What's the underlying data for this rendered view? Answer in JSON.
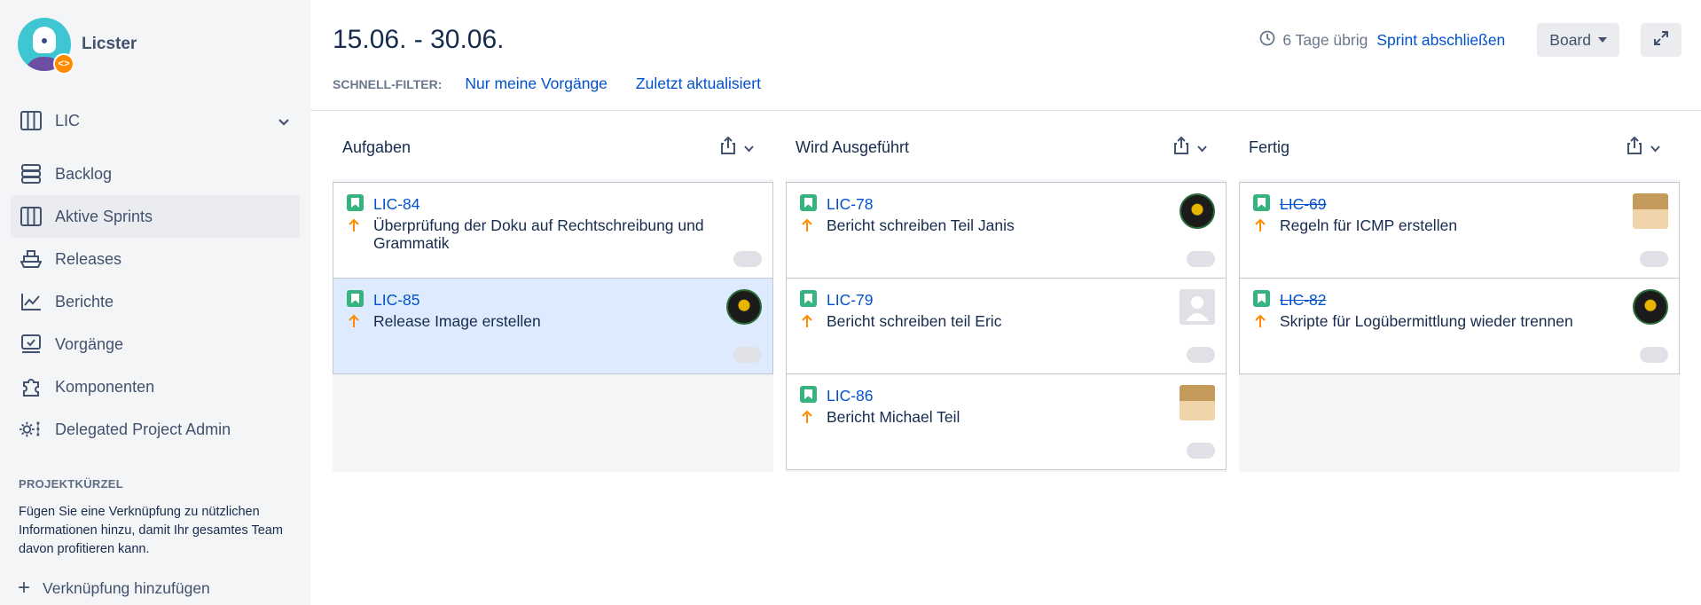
{
  "project": {
    "name": "Licster",
    "badge": "<>"
  },
  "sidebar": {
    "board_selector": "LIC",
    "items": [
      {
        "label": "Backlog",
        "icon": "backlog-icon"
      },
      {
        "label": "Aktive Sprints",
        "icon": "board-icon",
        "active": true
      },
      {
        "label": "Releases",
        "icon": "ship-icon"
      },
      {
        "label": "Berichte",
        "icon": "chart-icon"
      },
      {
        "label": "Vorgänge",
        "icon": "issues-icon"
      },
      {
        "label": "Komponenten",
        "icon": "puzzle-icon"
      },
      {
        "label": "Delegated Project Admin",
        "icon": "admin-icon"
      }
    ],
    "shortcuts_title": "PROJEKTKÜRZEL",
    "shortcuts_text": "Fügen Sie eine Verknüpfung zu nützlichen Informationen hinzu, damit Ihr gesamtes Team davon profitieren kann.",
    "add_link": "Verknüpfung hinzufügen"
  },
  "header": {
    "title": "15.06. - 30.06.",
    "quick_filter_label": "SCHNELL-FILTER:",
    "filters": [
      "Nur meine Vorgänge",
      "Zuletzt aktualisiert"
    ],
    "days_left": "6 Tage übrig",
    "complete_sprint": "Sprint abschließen",
    "board_button": "Board"
  },
  "columns": [
    {
      "name": "Aufgaben",
      "cards": [
        {
          "key": "LIC-84",
          "summary": "Überprüfung der Doku auf Rechtschreibung und Grammatik",
          "done": false,
          "avatar": ""
        },
        {
          "key": "LIC-85",
          "summary": "Release Image erstellen",
          "done": false,
          "avatar": "dark",
          "selected": true
        }
      ]
    },
    {
      "name": "Wird Ausgeführt",
      "cards": [
        {
          "key": "LIC-78",
          "summary": "Bericht schreiben Teil Janis",
          "done": false,
          "avatar": "dark"
        },
        {
          "key": "LIC-79",
          "summary": "Bericht schreiben teil Eric",
          "done": false,
          "avatar": "grey"
        },
        {
          "key": "LIC-86",
          "summary": "Bericht Michael Teil",
          "done": false,
          "avatar": "anime"
        }
      ]
    },
    {
      "name": "Fertig",
      "cards": [
        {
          "key": "LIC-69",
          "summary": "Regeln für ICMP erstellen",
          "done": true,
          "avatar": "anime"
        },
        {
          "key": "LIC-82",
          "summary": "Skripte für Logübermittlung wieder trennen",
          "done": true,
          "avatar": "dark"
        }
      ]
    }
  ],
  "colors": {
    "link": "#0052cc",
    "story": "#36b37e",
    "priority": "#ff8b00",
    "selected": "#deebff"
  }
}
